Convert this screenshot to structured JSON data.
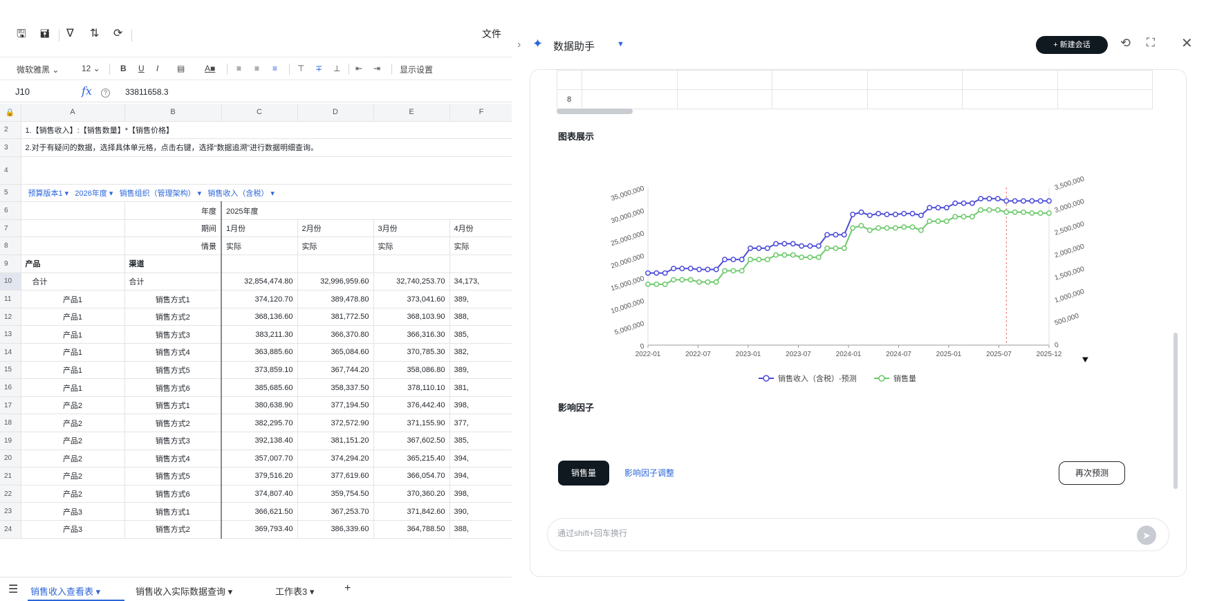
{
  "sheet": {
    "toolbar": {
      "file_label": "文件"
    },
    "format_bar": {
      "font_name": "微软雅黑 ⌄",
      "font_size": "12 ⌄",
      "bold": "B",
      "underline": "U",
      "italic": "I",
      "display_settings": "显示设置"
    },
    "formula_bar": {
      "cell_ref": "J10",
      "fx": "fx",
      "help": "?",
      "value": "33811658.3"
    },
    "columns": [
      "A",
      "B",
      "C",
      "D",
      "E",
      "F"
    ],
    "notes": [
      "1.【销售收入】:【销售数量】*【销售价格】",
      "2.对于有疑问的数据，选择具体单元格，点击右键，选择“数据追溯”进行数据明细查询。"
    ],
    "filters": [
      "预算版本1 ▾",
      "2026年度 ▾",
      "销售组织（管理架构） ▾",
      "销售收入（含税） ▾"
    ],
    "header_labels": {
      "year": "年度",
      "period": "期间",
      "scenario": "情景",
      "product": "产品",
      "channel": "渠道",
      "year_value": "2025年度",
      "months": [
        "1月份",
        "2月份",
        "3月份",
        "4月份"
      ],
      "scenario_value": "实际"
    },
    "total_row": {
      "product": "合计",
      "channel": "合计",
      "values": [
        "32,854,474.80",
        "32,996,959.60",
        "32,740,253.70",
        "34,173,"
      ]
    },
    "rows": [
      {
        "n": "11",
        "product": "产品1",
        "channel": "销售方式1",
        "values": [
          "374,120.70",
          "389,478.80",
          "373,041.60",
          "389,"
        ]
      },
      {
        "n": "12",
        "product": "产品1",
        "channel": "销售方式2",
        "values": [
          "368,136.60",
          "381,772.50",
          "368,103.90",
          "388,"
        ]
      },
      {
        "n": "13",
        "product": "产品1",
        "channel": "销售方式3",
        "values": [
          "383,211.30",
          "366,370.80",
          "366,316.30",
          "385,"
        ]
      },
      {
        "n": "14",
        "product": "产品1",
        "channel": "销售方式4",
        "values": [
          "363,885.60",
          "365,084.60",
          "370,785.30",
          "382,"
        ]
      },
      {
        "n": "15",
        "product": "产品1",
        "channel": "销售方式5",
        "values": [
          "373,859.10",
          "367,744.20",
          "358,086.80",
          "389,"
        ]
      },
      {
        "n": "16",
        "product": "产品1",
        "channel": "销售方式6",
        "values": [
          "385,685.60",
          "358,337.50",
          "378,110.10",
          "381,"
        ]
      },
      {
        "n": "17",
        "product": "产品2",
        "channel": "销售方式1",
        "values": [
          "380,638.90",
          "377,194.50",
          "376,442.40",
          "398,"
        ]
      },
      {
        "n": "18",
        "product": "产品2",
        "channel": "销售方式2",
        "values": [
          "382,295.70",
          "372,572.90",
          "371,155.90",
          "377,"
        ]
      },
      {
        "n": "19",
        "product": "产品2",
        "channel": "销售方式3",
        "values": [
          "392,138.40",
          "381,151.20",
          "367,602.50",
          "385,"
        ]
      },
      {
        "n": "20",
        "product": "产品2",
        "channel": "销售方式4",
        "values": [
          "357,007.70",
          "374,294.20",
          "365,215.40",
          "394,"
        ]
      },
      {
        "n": "21",
        "product": "产品2",
        "channel": "销售方式5",
        "values": [
          "379,516.20",
          "377,619.60",
          "366,054.70",
          "394,"
        ]
      },
      {
        "n": "22",
        "product": "产品2",
        "channel": "销售方式6",
        "values": [
          "374,807.40",
          "359,754.50",
          "370,360.20",
          "398,"
        ]
      },
      {
        "n": "23",
        "product": "产品3",
        "channel": "销售方式1",
        "values": [
          "366,621.50",
          "367,253.70",
          "371,842.60",
          "390,"
        ]
      },
      {
        "n": "24",
        "product": "产品3",
        "channel": "销售方式2",
        "values": [
          "369,793.40",
          "386,339.60",
          "364,788.50",
          "388,"
        ]
      }
    ],
    "tabs": [
      "销售收入查看表 ▾",
      "销售收入实际数据查询 ▾",
      "工作表3 ▾",
      "+"
    ]
  },
  "assistant": {
    "title": "数据助手",
    "new_chat": "+ 新建会话",
    "mini_table_row": "8",
    "chart_section_title": "图表展示",
    "factors_title": "影响因子",
    "factor_chip": "销售量",
    "factor_link": "影响因子调整",
    "repredict": "再次预测",
    "input_placeholder": "通过shift+回车换行"
  },
  "chart_data": {
    "type": "line",
    "x_ticks": [
      "2022-01",
      "2022-07",
      "2023-01",
      "2023-07",
      "2024-01",
      "2024-07",
      "2025-01",
      "2025-07",
      "2025-12"
    ],
    "y_left_ticks": [
      "0",
      "5,000,000",
      "10,000,000",
      "15,000,000",
      "20,000,000",
      "25,000,000",
      "30,000,000",
      "35,000,000"
    ],
    "y_right_ticks": [
      "0",
      "500,000",
      "1,000,000",
      "1,500,000",
      "2,000,000",
      "2,500,000",
      "3,000,000",
      "3,500,000"
    ],
    "ylim_left": [
      0,
      35000000
    ],
    "ylim_right": [
      0,
      3500000
    ],
    "forecast_marker_index": 42,
    "series": [
      {
        "name": "销售收入（含税）-预测",
        "axis": "left",
        "color": "#4b4bd8",
        "values": [
          16000000,
          16000000,
          16000000,
          17000000,
          17000000,
          17000000,
          16800000,
          16800000,
          16800000,
          19000000,
          19000000,
          19000000,
          21500000,
          21500000,
          21500000,
          22500000,
          22500000,
          22500000,
          22000000,
          22000000,
          22000000,
          24500000,
          24500000,
          24500000,
          29000000,
          29500000,
          28800000,
          29200000,
          29000000,
          29000000,
          29200000,
          29200000,
          28800000,
          30500000,
          30500000,
          30500000,
          31500000,
          31500000,
          31500000,
          32500000,
          32500000,
          32500000,
          32000000,
          32000000,
          32000000,
          32000000,
          32000000,
          32000000
        ]
      },
      {
        "name": "销售量",
        "axis": "right",
        "color": "#6ac96a",
        "values": [
          1350000,
          1350000,
          1350000,
          1450000,
          1450000,
          1450000,
          1400000,
          1400000,
          1400000,
          1650000,
          1650000,
          1650000,
          1900000,
          1900000,
          1900000,
          2000000,
          2000000,
          2000000,
          1950000,
          1950000,
          1950000,
          2150000,
          2150000,
          2150000,
          2600000,
          2650000,
          2550000,
          2600000,
          2600000,
          2600000,
          2620000,
          2620000,
          2550000,
          2750000,
          2750000,
          2750000,
          2850000,
          2850000,
          2850000,
          3000000,
          3000000,
          3000000,
          2950000,
          2950000,
          2950000,
          2930000,
          2930000,
          2930000
        ]
      }
    ],
    "legend": "bottom-center"
  }
}
